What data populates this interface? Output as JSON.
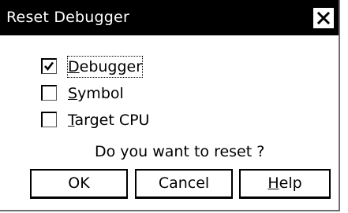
{
  "window": {
    "title": "Reset Debugger",
    "close_icon": "close-icon"
  },
  "options": [
    {
      "label_underlined": "D",
      "label_rest": "ebugger",
      "checked": true,
      "focused": true
    },
    {
      "label_underlined": "S",
      "label_rest": "ymbol",
      "checked": false,
      "focused": false
    },
    {
      "label_underlined": "T",
      "label_rest": "arget CPU",
      "checked": false,
      "focused": false
    }
  ],
  "prompt": "Do you want to reset ?",
  "buttons": {
    "ok": "OK",
    "cancel": "Cancel",
    "help_underlined": "H",
    "help_rest": "elp"
  },
  "colors": {
    "titlebar_bg": "#000000",
    "titlebar_text": "#ffffff",
    "dialog_bg": "#ffffff"
  }
}
